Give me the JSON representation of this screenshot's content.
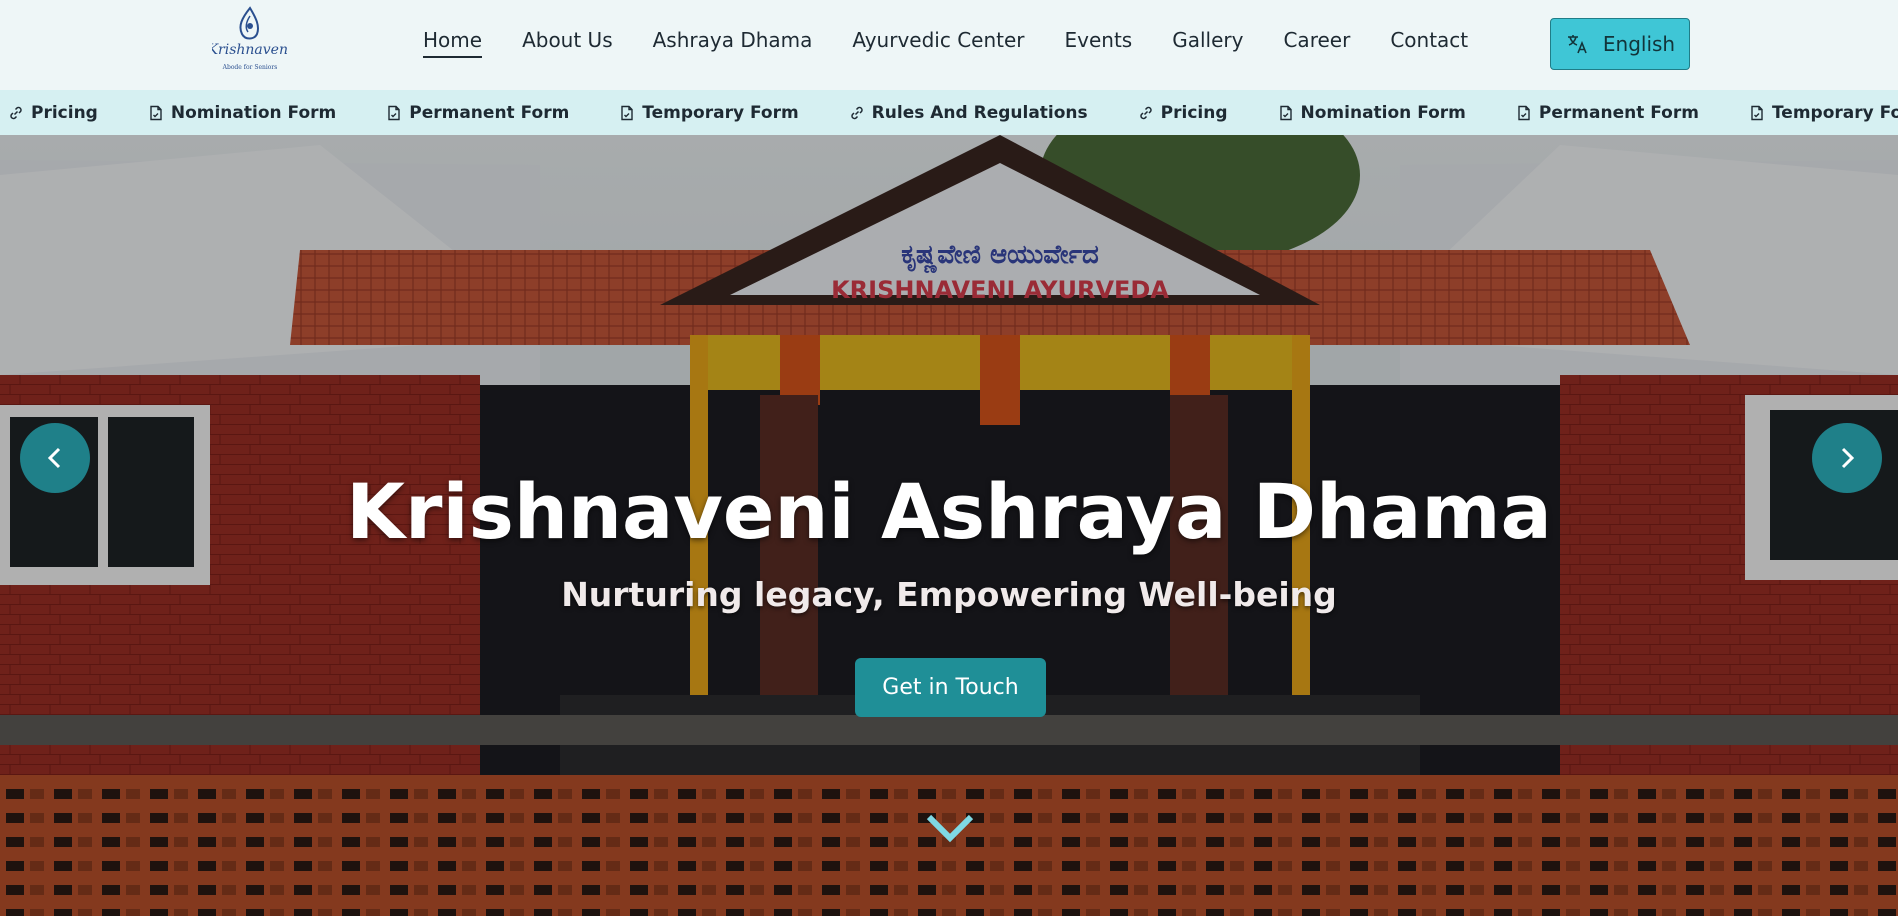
{
  "header": {
    "logo_alt": "Krishnaveni Ashraya Dhama",
    "logo_script": "Krishnaveni",
    "logo_sub": "Abode for Seniors",
    "nav": [
      {
        "label": "Home",
        "active": true
      },
      {
        "label": "About Us"
      },
      {
        "label": "Ashraya Dhama"
      },
      {
        "label": "Ayurvedic Center"
      },
      {
        "label": "Events"
      },
      {
        "label": "Gallery"
      },
      {
        "label": "Career"
      },
      {
        "label": "Contact"
      }
    ],
    "language": {
      "label": "English",
      "icon": "translate-icon"
    }
  },
  "ticker": {
    "items": [
      {
        "label": "Pricing",
        "icon": "link-icon"
      },
      {
        "label": "Nomination Form",
        "icon": "document-icon"
      },
      {
        "label": "Permanent Form",
        "icon": "document-icon"
      },
      {
        "label": "Temporary Form",
        "icon": "document-icon"
      },
      {
        "label": "Rules And Regulations",
        "icon": "link-icon"
      },
      {
        "label": "Pricing",
        "icon": "link-icon"
      },
      {
        "label": "Nomination Form",
        "icon": "document-icon"
      },
      {
        "label": "Permanent Form",
        "icon": "document-icon"
      },
      {
        "label": "Temporary Form",
        "icon": "document-icon"
      },
      {
        "label": "",
        "icon": "link-icon"
      }
    ]
  },
  "hero": {
    "title": "Krishnaveni Ashraya Dhama",
    "subtitle": "Nurturing legacy, Empowering Well-being",
    "cta_label": "Get in Touch",
    "prev_icon": "chevron-left-icon",
    "next_icon": "chevron-right-icon",
    "scroll_icon": "chevron-down-icon",
    "sign_kannada": "ಕೃಷ್ಣವೇಣಿ ಆಯುರ್ವೇದ",
    "sign_english": "KRISHNAVENI AYURVEDA"
  },
  "colors": {
    "accent": "#3fc6d6",
    "button": "#1f8f97",
    "header_bg": "#eef6f7",
    "ticker_bg": "#d6f0f2"
  }
}
